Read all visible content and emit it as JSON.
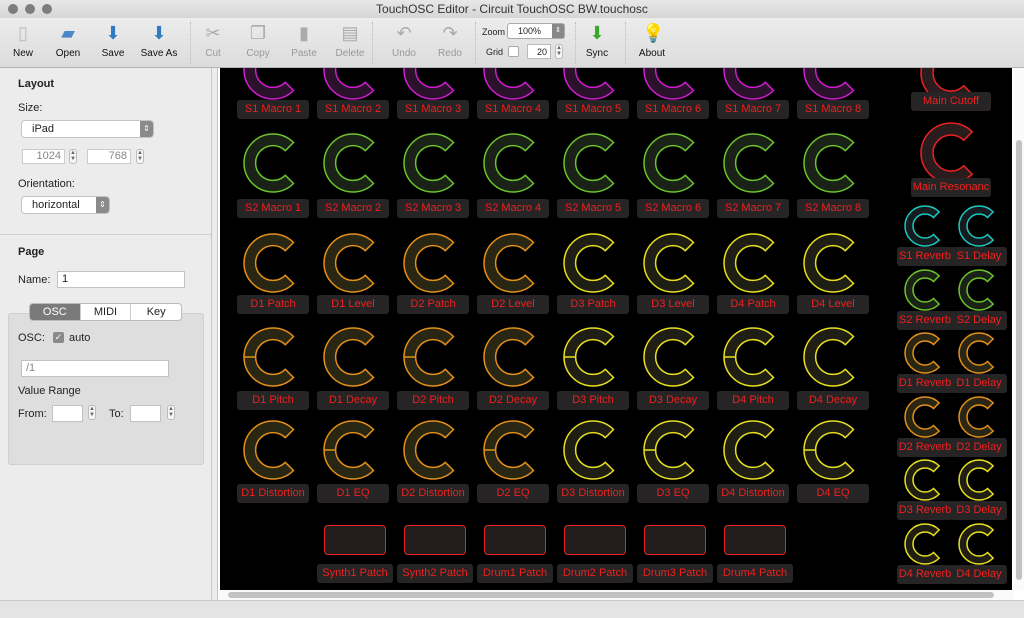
{
  "window": {
    "title": "TouchOSC Editor - Circuit TouchOSC BW.touchosc"
  },
  "toolbar": {
    "buttons": [
      {
        "label": "New",
        "icon": "new-document-icon",
        "enabled": true
      },
      {
        "label": "Open",
        "icon": "folder-icon",
        "enabled": true
      },
      {
        "label": "Save",
        "icon": "save-icon",
        "enabled": true
      },
      {
        "label": "Save As",
        "icon": "save-as-icon",
        "enabled": true
      },
      {
        "label": "Cut",
        "icon": "scissors-icon",
        "enabled": false
      },
      {
        "label": "Copy",
        "icon": "copy-icon",
        "enabled": false
      },
      {
        "label": "Paste",
        "icon": "clipboard-icon",
        "enabled": false
      },
      {
        "label": "Delete",
        "icon": "trash-icon",
        "enabled": false
      },
      {
        "label": "Undo",
        "icon": "undo-icon",
        "enabled": false
      },
      {
        "label": "Redo",
        "icon": "redo-icon",
        "enabled": false
      },
      {
        "label": "Sync",
        "icon": "sync-arrow-icon",
        "enabled": true
      },
      {
        "label": "About",
        "icon": "lightbulb-icon",
        "enabled": true
      }
    ],
    "zoom_label": "Zoom",
    "zoom_value": "100%",
    "grid_label": "Grid",
    "grid_checked": false,
    "grid_size": "20"
  },
  "layout": {
    "heading": "Layout",
    "size_label": "Size:",
    "size_value": "iPad",
    "width": "1024",
    "height": "768",
    "orientation_label": "Orientation:",
    "orientation_value": "horizontal"
  },
  "page": {
    "heading": "Page",
    "name_label": "Name:",
    "name_value": "1",
    "tabs": [
      "OSC",
      "MIDI",
      "Key"
    ],
    "active_tab": "OSC",
    "osc_label": "OSC:",
    "auto_label": "auto",
    "auto_checked": true,
    "osc_address": "/1",
    "value_range_label": "Value Range",
    "from_label": "From:",
    "from_value": "",
    "to_label": "To:",
    "to_value": ""
  },
  "colors": {
    "magenta": "#d21ad2",
    "green": "#6cc42a",
    "orange": "#e39018",
    "yellow": "#e8e01c",
    "cyan": "#1cc8c0",
    "red": "#ec2222",
    "label_text": "#f02020",
    "label_bg": "#262424"
  },
  "grid_rows": [
    {
      "color": "magenta",
      "knobs": [
        {
          "label": "S1 Macro 1"
        },
        {
          "label": "S1 Macro 2"
        },
        {
          "label": "S1 Macro 3"
        },
        {
          "label": "S1 Macro 4"
        },
        {
          "label": "S1 Macro 5"
        },
        {
          "label": "S1 Macro 6"
        },
        {
          "label": "S1 Macro 7"
        },
        {
          "label": "S1 Macro 8"
        }
      ]
    },
    {
      "color": "green",
      "knobs": [
        {
          "label": "S2 Macro 1"
        },
        {
          "label": "S2 Macro 2"
        },
        {
          "label": "S2 Macro 3"
        },
        {
          "label": "S2 Macro 4"
        },
        {
          "label": "S2 Macro 5"
        },
        {
          "label": "S2 Macro 6"
        },
        {
          "label": "S2 Macro 7"
        },
        {
          "label": "S2 Macro 8"
        }
      ]
    },
    {
      "colors": [
        "orange",
        "orange",
        "orange",
        "orange",
        "yellow",
        "yellow",
        "yellow",
        "yellow"
      ],
      "knobs": [
        {
          "label": "D1 Patch"
        },
        {
          "label": "D1 Level"
        },
        {
          "label": "D2 Patch"
        },
        {
          "label": "D2 Level"
        },
        {
          "label": "D3 Patch"
        },
        {
          "label": "D3 Level"
        },
        {
          "label": "D4 Patch"
        },
        {
          "label": "D4 Level"
        }
      ]
    },
    {
      "colors": [
        "orange",
        "orange",
        "orange",
        "orange",
        "yellow",
        "yellow",
        "yellow",
        "yellow"
      ],
      "knobs": [
        {
          "label": "D1 Pitch",
          "centered": true
        },
        {
          "label": "D1 Decay"
        },
        {
          "label": "D2 Pitch",
          "centered": true
        },
        {
          "label": "D2 Decay"
        },
        {
          "label": "D3 Pitch",
          "centered": true
        },
        {
          "label": "D3 Decay"
        },
        {
          "label": "D4 Pitch",
          "centered": true
        },
        {
          "label": "D4 Decay"
        }
      ]
    },
    {
      "colors": [
        "orange",
        "orange",
        "orange",
        "orange",
        "yellow",
        "yellow",
        "yellow",
        "yellow"
      ],
      "knobs": [
        {
          "label": "D1 Distortion"
        },
        {
          "label": "D1 EQ",
          "centered": true
        },
        {
          "label": "D2 Distortion"
        },
        {
          "label": "D2 EQ",
          "centered": true
        },
        {
          "label": "D3 Distortion"
        },
        {
          "label": "D3 EQ",
          "centered": true
        },
        {
          "label": "D4 Distortion"
        },
        {
          "label": "D4 EQ",
          "centered": true
        }
      ]
    }
  ],
  "pads": [
    {
      "label": "Synth1 Patch"
    },
    {
      "label": "Synth2 Patch"
    },
    {
      "label": "Drum1 Patch"
    },
    {
      "label": "Drum2 Patch"
    },
    {
      "label": "Drum3 Patch"
    },
    {
      "label": "Drum4 Patch"
    }
  ],
  "main_knobs": [
    {
      "label": "Main Cutoff",
      "color": "red"
    },
    {
      "label": "Main Resonanc",
      "color": "red"
    }
  ],
  "fx_rows": [
    {
      "color": "cyan",
      "knobs": [
        {
          "label": "S1 Reverb"
        },
        {
          "label": "S1 Delay"
        }
      ]
    },
    {
      "color": "green",
      "knobs": [
        {
          "label": "S2 Reverb"
        },
        {
          "label": "S2 Delay"
        }
      ]
    },
    {
      "color": "orange",
      "knobs": [
        {
          "label": "D1 Reverb"
        },
        {
          "label": "D1 Delay"
        }
      ]
    },
    {
      "color": "orange",
      "knobs": [
        {
          "label": "D2 Reverb"
        },
        {
          "label": "D2 Delay"
        }
      ]
    },
    {
      "color": "yellow",
      "knobs": [
        {
          "label": "D3 Reverb"
        },
        {
          "label": "D3 Delay"
        }
      ]
    },
    {
      "color": "yellow",
      "knobs": [
        {
          "label": "D4 Reverb"
        },
        {
          "label": "D4 Delay"
        }
      ]
    }
  ]
}
